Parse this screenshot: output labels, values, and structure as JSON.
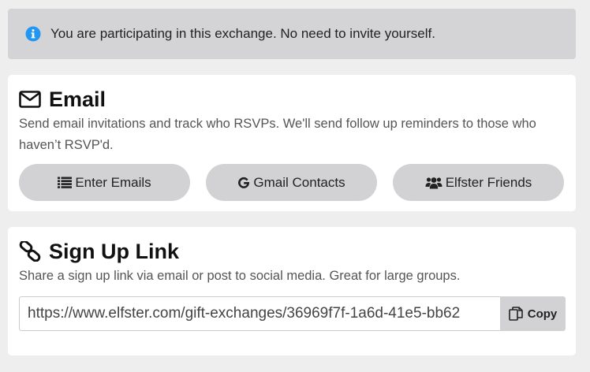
{
  "alert": {
    "icon": "info-circle-icon",
    "message": "You are participating in this exchange. No need to invite yourself."
  },
  "email_section": {
    "icon": "envelope-icon",
    "title": "Email",
    "description": "Send email invitations and track who RSVPs. We'll send follow up reminders to those who haven’t RSVP'd.",
    "buttons": [
      {
        "icon": "list-icon",
        "label": "Enter Emails"
      },
      {
        "icon": "google-g-icon",
        "label": "Gmail Contacts"
      },
      {
        "icon": "users-icon",
        "label": "Elfster Friends"
      }
    ]
  },
  "signup_section": {
    "icon": "link-icon",
    "title": "Sign Up Link",
    "description": "Share a sign up link via email or post to social media. Great for large groups.",
    "link_value": "https://www.elfster.com/gift-exchanges/36969f7f-1a6d-41e5-bb62",
    "copy_label": "Copy",
    "copy_icon": "copy-icon"
  },
  "colors": {
    "alert_bg": "#d4d4d6",
    "info_blue": "#2196f3",
    "button_bg": "#d2d2d4",
    "card_bg": "#ffffff",
    "page_bg": "#eeeeee"
  }
}
